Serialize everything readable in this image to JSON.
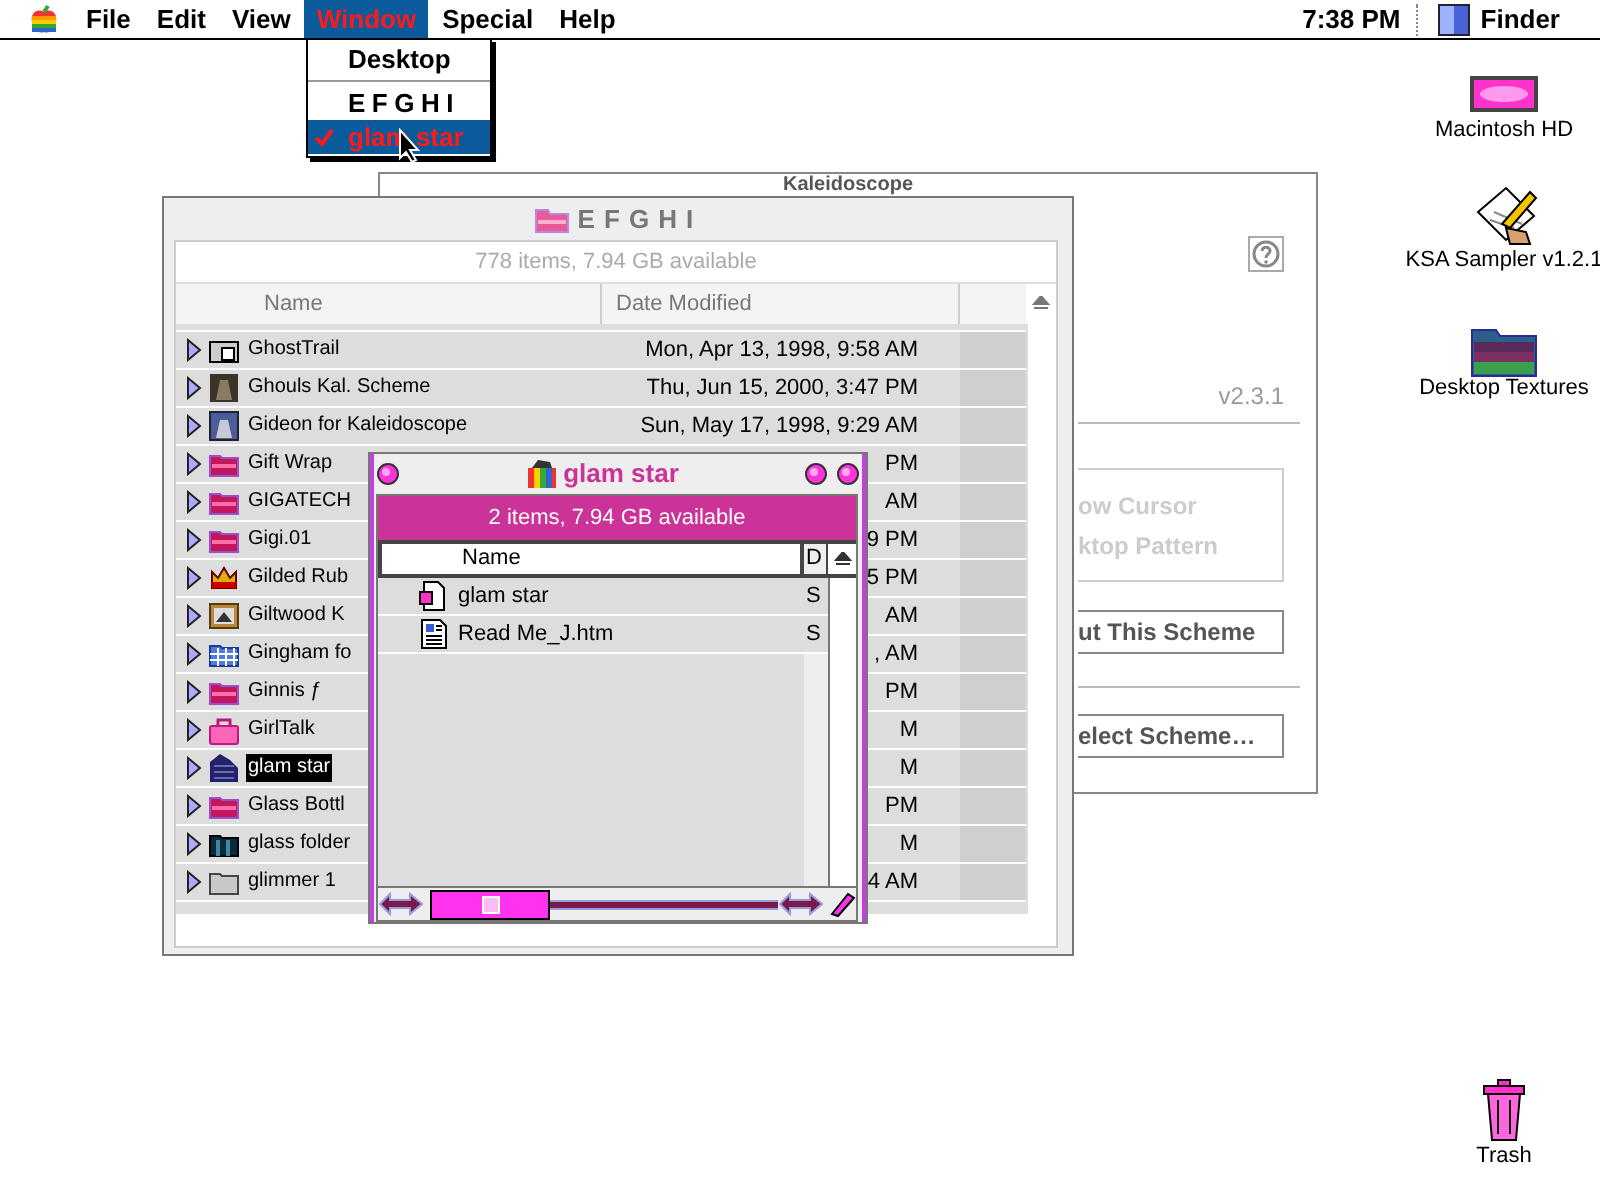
{
  "menu_bar": {
    "items": [
      {
        "label": "File",
        "selected": false
      },
      {
        "label": "Edit",
        "selected": false
      },
      {
        "label": "View",
        "selected": false
      },
      {
        "label": "Window",
        "selected": true
      },
      {
        "label": "Special",
        "selected": false
      },
      {
        "label": "Help",
        "selected": false
      }
    ],
    "clock": "7:38 PM",
    "app": "Finder"
  },
  "window_menu": {
    "items": [
      {
        "kind": "item",
        "label": "Desktop",
        "checked": false,
        "selected": false
      },
      {
        "kind": "separator"
      },
      {
        "kind": "item",
        "label": "EFGHI",
        "checked": false,
        "selected": false
      },
      {
        "kind": "item",
        "label": "glam star",
        "checked": true,
        "selected": true
      }
    ]
  },
  "desktop_icons": [
    {
      "kind": "disk",
      "label": "Macintosh HD"
    },
    {
      "kind": "document",
      "label": "KSA Sampler v1.2.1"
    },
    {
      "kind": "folder",
      "label": "Desktop Textures"
    },
    {
      "kind": "trash",
      "label": "Trash"
    }
  ],
  "kaleidoscope_window": {
    "title": "Kaleidoscope",
    "version": "v2.3.1",
    "options": [
      {
        "label": "ow Cursor",
        "disabled": true
      },
      {
        "label": "ktop Pattern",
        "disabled": true
      }
    ],
    "buttons": [
      "ut This Scheme",
      "elect Scheme…"
    ]
  },
  "efghi_window": {
    "title": "EFGHI",
    "info": "778 items, 7.94 GB available",
    "columns": [
      "Name",
      "Date Modified"
    ],
    "rows": [
      {
        "kind": "box",
        "name": "GhostTrail",
        "date": "Mon, Apr 13, 1998, 9:58 AM",
        "selected": false
      },
      {
        "kind": "dark-picture",
        "name": "Ghouls Kal. Scheme",
        "date": "Thu, Jun 15, 2000, 3:47 PM",
        "selected": false
      },
      {
        "kind": "blue-picture",
        "name": "Gideon for Kaleidoscope",
        "date": "Sun, May 17, 1998, 9:29 AM",
        "selected": false
      },
      {
        "kind": "pink-folder",
        "name": "Gift Wrap",
        "date": "PM",
        "selected": false
      },
      {
        "kind": "pink-folder",
        "name": "GIGATECH",
        "date": "AM",
        "selected": false
      },
      {
        "kind": "pink-folder",
        "name": "Gigi.01",
        "date": "9 PM",
        "selected": false
      },
      {
        "kind": "crown",
        "name": "Gilded Rub",
        "date": "5 PM",
        "selected": false
      },
      {
        "kind": "framed-picture",
        "name": "Giltwood K",
        "date": "AM",
        "selected": false
      },
      {
        "kind": "gingham",
        "name": "Gingham fo",
        "date": ", AM",
        "selected": false
      },
      {
        "kind": "pink-folder",
        "name": "Ginnis ƒ",
        "date": "PM",
        "selected": false
      },
      {
        "kind": "bag",
        "name": "GirlTalk",
        "date": "M",
        "selected": false
      },
      {
        "kind": "dark-building",
        "name": "glam star",
        "date": "M",
        "selected": true
      },
      {
        "kind": "pink-folder",
        "name": "Glass Bottl",
        "date": "PM",
        "selected": false
      },
      {
        "kind": "dark-folder",
        "name": "glass folder",
        "date": "M",
        "selected": false
      },
      {
        "kind": "grey-folder",
        "name": "glimmer 1",
        "date": "4 AM",
        "selected": false
      }
    ]
  },
  "glam_star_window": {
    "title": "glam star",
    "info": "2 items, 7.94 GB available",
    "columns": [
      "Name",
      "D"
    ],
    "rows": [
      {
        "kind": "pink-doc",
        "name": "glam star",
        "date": "S"
      },
      {
        "kind": "web-doc",
        "name": "Read Me_J.htm",
        "date": "S"
      }
    ]
  }
}
